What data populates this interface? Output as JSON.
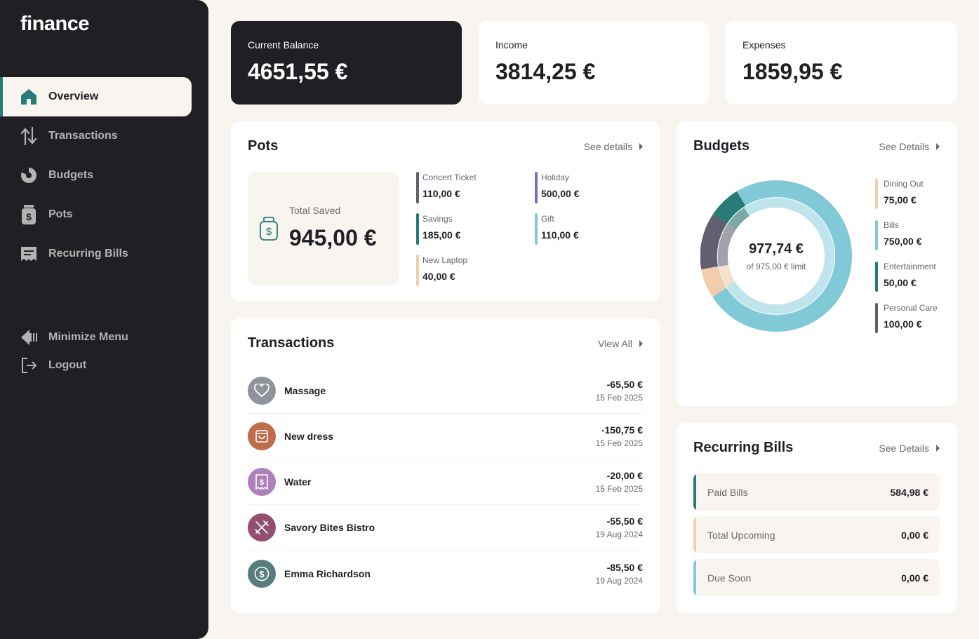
{
  "app": {
    "logo": "finance"
  },
  "nav": {
    "items": [
      {
        "label": "Overview",
        "icon": "home-icon"
      },
      {
        "label": "Transactions",
        "icon": "arrows-up-down-icon"
      },
      {
        "label": "Budgets",
        "icon": "pie-chart-icon"
      },
      {
        "label": "Pots",
        "icon": "jar-icon"
      },
      {
        "label": "Recurring Bills",
        "icon": "receipt-icon"
      }
    ],
    "minimize": "Minimize Menu",
    "logout": "Logout"
  },
  "summary": {
    "balance": {
      "label": "Current Balance",
      "amount": "4651,55 €"
    },
    "income": {
      "label": "Income",
      "amount": "3814,25 €"
    },
    "expenses": {
      "label": "Expenses",
      "amount": "1859,95 €"
    }
  },
  "pots": {
    "title": "Pots",
    "link": "See details",
    "total_label": "Total Saved",
    "total_amount": "945,00 €",
    "items": [
      {
        "name": "Concert Ticket",
        "value": "110,00 €",
        "color": "#626070"
      },
      {
        "name": "Holiday",
        "value": "500,00 €",
        "color": "#826cb0"
      },
      {
        "name": "Savings",
        "value": "185,00 €",
        "color": "#277c78"
      },
      {
        "name": "Gift",
        "value": "110,00 €",
        "color": "#82c9d7"
      },
      {
        "name": "New Laptop",
        "value": "40,00 €",
        "color": "#f2cdac"
      }
    ]
  },
  "transactions": {
    "title": "Transactions",
    "link": "View All",
    "items": [
      {
        "name": "Massage",
        "amount": "-65,50 €",
        "date": "15 Feb 2025",
        "color": "#8f939c",
        "icon": "heart-icon"
      },
      {
        "name": "New dress",
        "amount": "-150,75 €",
        "date": "15 Feb 2025",
        "color": "#be6c49",
        "icon": "shopping-bag-icon"
      },
      {
        "name": "Water",
        "amount": "-20,00 €",
        "date": "15 Feb 2025",
        "color": "#af81ba",
        "icon": "receipt-icon"
      },
      {
        "name": "Savory Bites Bistro",
        "amount": "-55,50 €",
        "date": "19 Aug 2024",
        "color": "#934f6f",
        "icon": "utensils-icon"
      },
      {
        "name": "Emma Richardson",
        "amount": "-85,50 €",
        "date": "19 Aug 2024",
        "color": "#597c7c",
        "icon": "dollar-icon"
      }
    ]
  },
  "budgets": {
    "title": "Budgets",
    "link": "See Details",
    "spent": "977,74 €",
    "limit_text": "of 975,00 € limit",
    "items": [
      {
        "name": "Dining Out",
        "value": "75,00 €",
        "color": "#f2cdac"
      },
      {
        "name": "Bills",
        "value": "750,00 €",
        "color": "#82c9d7"
      },
      {
        "name": "Entertainment",
        "value": "50,00 €",
        "color": "#277c78"
      },
      {
        "name": "Personal Care",
        "value": "100,00 €",
        "color": "#626070"
      }
    ]
  },
  "bills": {
    "title": "Recurring Bills",
    "link": "See Details",
    "items": [
      {
        "name": "Paid Bills",
        "value": "584,98 €",
        "color": "#277c78"
      },
      {
        "name": "Total Upcoming",
        "value": "0,00 €",
        "color": "#f2cdac"
      },
      {
        "name": "Due Soon",
        "value": "0,00 €",
        "color": "#82c9d7"
      }
    ]
  }
}
